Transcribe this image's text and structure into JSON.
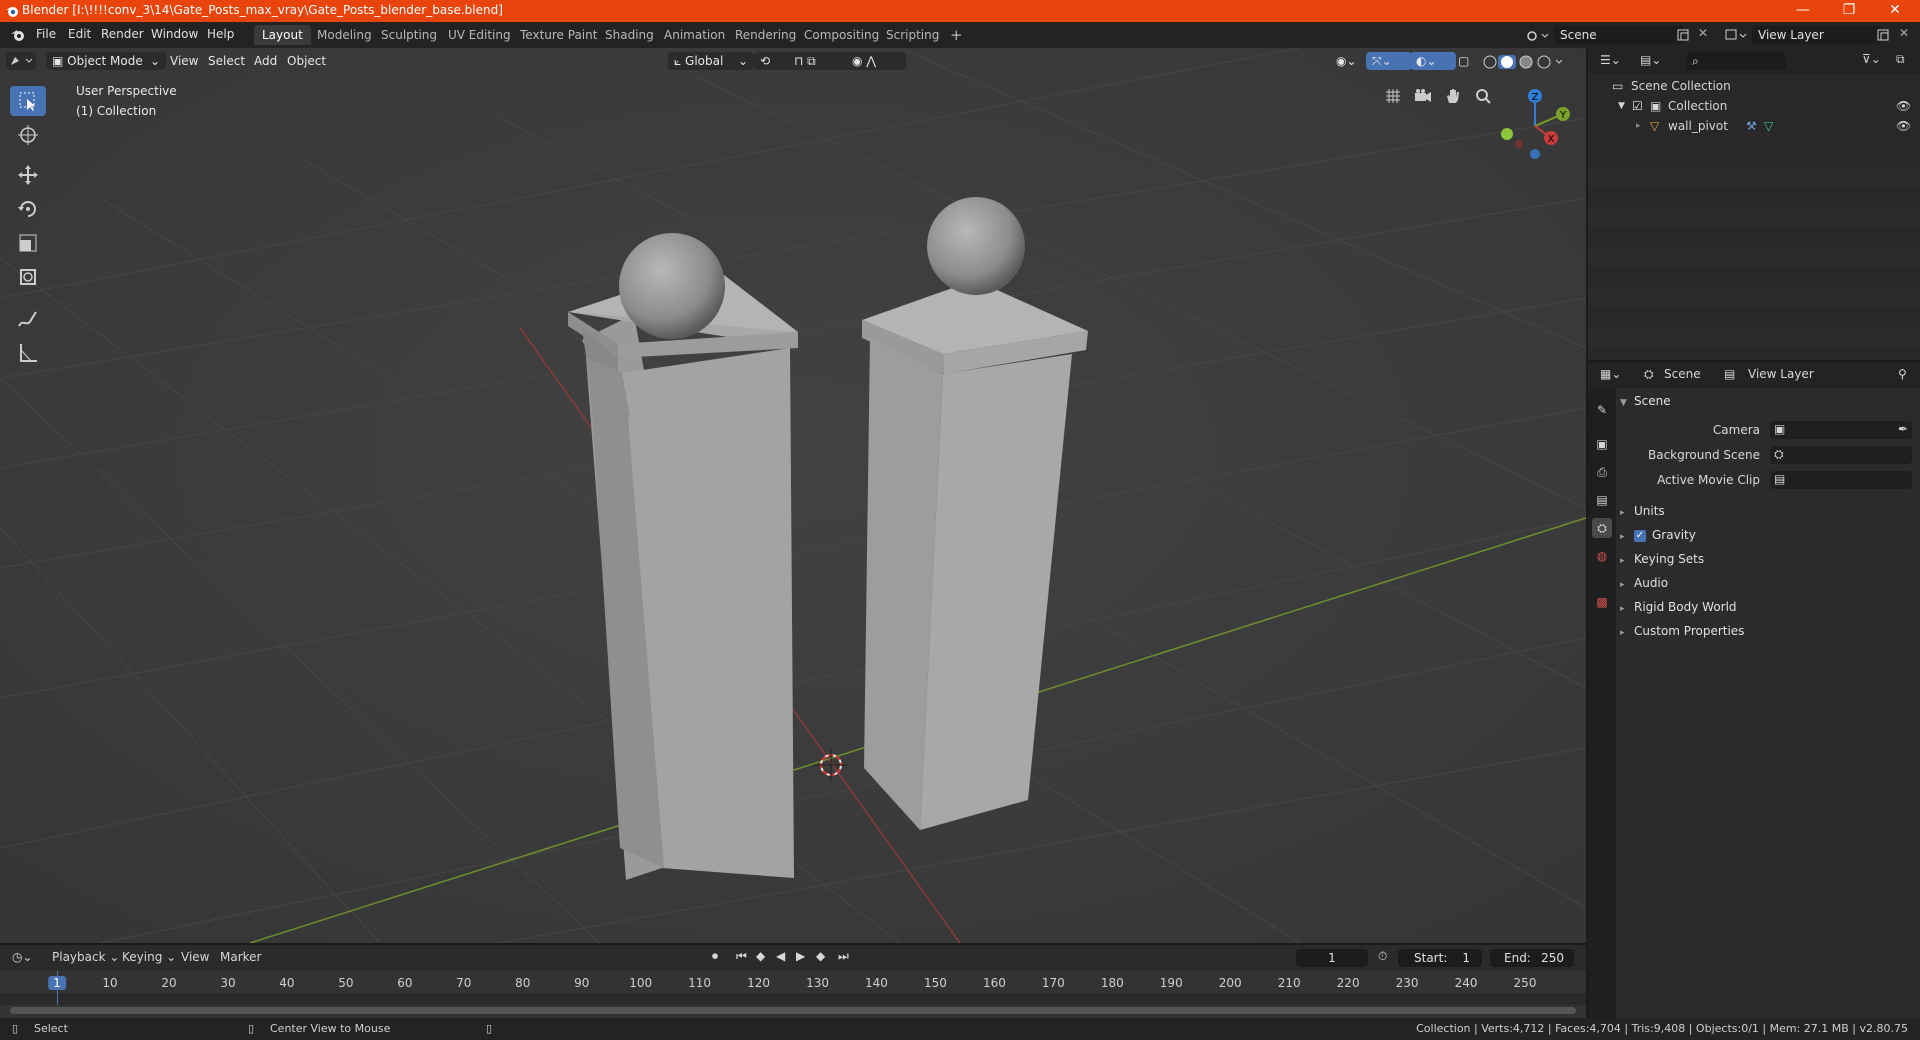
{
  "window": {
    "title": "Blender [I:\\!!!!conv_3\\14\\Gate_Posts_max_vray\\Gate_Posts_blender_base.blend]",
    "minimize": "—",
    "maximize": "❐",
    "close": "✕"
  },
  "menu": [
    "File",
    "Edit",
    "Render",
    "Window",
    "Help"
  ],
  "workspaces": [
    "Layout",
    "Modeling",
    "Sculpting",
    "UV Editing",
    "Texture Paint",
    "Shading",
    "Animation",
    "Rendering",
    "Compositing",
    "Scripting"
  ],
  "active_workspace": "Layout",
  "add_workspace": "+",
  "scene_field": "Scene",
  "view_layer_field": "View Layer",
  "viewport_header": {
    "mode": "Object Mode",
    "menus": [
      "View",
      "Select",
      "Add",
      "Object"
    ],
    "orientation": "Global"
  },
  "viewport": {
    "perspective": "User Perspective",
    "collection": "(1) Collection",
    "gizmo": {
      "x": "X",
      "y": "Y",
      "z": "Z"
    }
  },
  "outliner": {
    "root": "Scene Collection",
    "collection": "Collection",
    "object": "wall_pivot"
  },
  "properties": {
    "tabs": [
      "Scene",
      "View Layer"
    ],
    "section_title": "Scene",
    "fields": [
      {
        "label": "Camera"
      },
      {
        "label": "Background Scene"
      },
      {
        "label": "Active Movie Clip"
      }
    ],
    "subsections": [
      "Units",
      "Gravity",
      "Keying Sets",
      "Audio",
      "Rigid Body World",
      "Custom Properties"
    ],
    "gravity_checked": true
  },
  "timeline": {
    "menus": [
      "Playback",
      "Keying",
      "View",
      "Marker"
    ],
    "current_frame": "1",
    "start_label": "Start:",
    "start": "1",
    "end_label": "End:",
    "end": "250",
    "ticks": [
      "1",
      "10",
      "20",
      "30",
      "40",
      "50",
      "60",
      "70",
      "80",
      "90",
      "100",
      "110",
      "120",
      "130",
      "140",
      "150",
      "160",
      "170",
      "180",
      "190",
      "200",
      "210",
      "220",
      "230",
      "240",
      "250"
    ]
  },
  "status": {
    "left_action": "Select",
    "middle_action": "Center View to Mouse",
    "stats": "Collection | Verts:4,712 | Faces:4,704 | Tris:9,408 | Objects:0/1 | Mem: 27.1 MB | v2.80.75"
  },
  "colors": {
    "titlebar": "#e8440c",
    "accent": "#4772b3",
    "x_axis": "#c73b3b",
    "y_axis": "#7ca02a",
    "z_axis": "#2f7fd8"
  }
}
